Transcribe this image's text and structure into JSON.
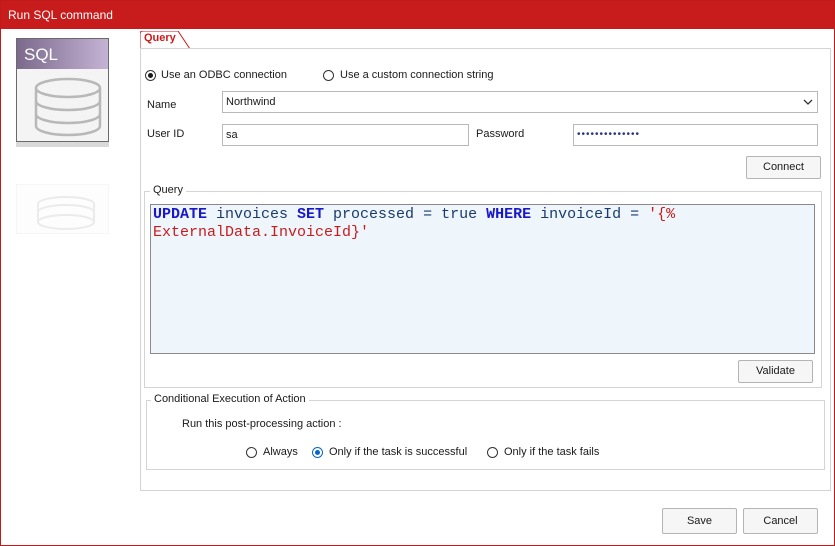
{
  "window": {
    "title": "Run SQL command"
  },
  "icon": {
    "label": "SQL"
  },
  "tab": {
    "label": "Query"
  },
  "connection": {
    "odbc_label": "Use an ODBC connection",
    "custom_label": "Use a custom connection string",
    "selected": "odbc"
  },
  "fields": {
    "name_label": "Name",
    "name_value": "Northwind",
    "userid_label": "User ID",
    "userid_value": "sa",
    "password_label": "Password",
    "password_value": "••••••••••••••",
    "connect_label": "Connect"
  },
  "query": {
    "group_title": "Query",
    "tokens_line1": [
      {
        "t": "UPDATE",
        "c": "kw"
      },
      {
        "t": " invoices ",
        "c": ""
      },
      {
        "t": "SET",
        "c": "kw"
      },
      {
        "t": " processed = true ",
        "c": ""
      },
      {
        "t": "WHERE",
        "c": "kw"
      },
      {
        "t": " invoiceId = ",
        "c": ""
      },
      {
        "t": "'{%",
        "c": "str"
      }
    ],
    "tokens_line2": [
      {
        "t": "ExternalData.InvoiceId}'",
        "c": "str"
      }
    ],
    "validate_label": "Validate"
  },
  "conditional": {
    "group_title": "Conditional Execution of Action",
    "prompt": "Run this post-processing action :",
    "options": [
      "Always",
      "Only if the task is successful",
      "Only if the task fails"
    ],
    "selected_index": 1
  },
  "footer": {
    "save_label": "Save",
    "cancel_label": "Cancel"
  },
  "colors": {
    "accent": "#c81c1c",
    "keyword": "#1818c8",
    "editor_bg": "#eef6fc"
  }
}
